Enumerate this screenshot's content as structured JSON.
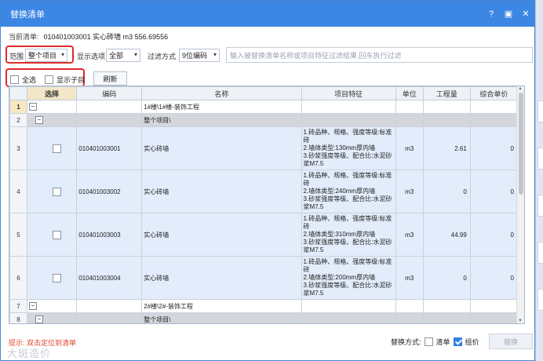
{
  "dialog": {
    "title": "替换清单",
    "buttons": {
      "help": "?",
      "restore": "▣",
      "close": "✕"
    }
  },
  "current": {
    "label": "当前清单:",
    "value": "010401003001 实心砖墙 m3 556.69556"
  },
  "filters": {
    "scope_label": "范围",
    "scope_value": "整个项目",
    "display_label": "显示选项",
    "display_value": "全部",
    "filter_label": "过滤方式",
    "filter_value": "9位编码",
    "search_placeholder": "输入被替换清单名称或项目特征过滤结果,回车执行过滤"
  },
  "options": {
    "select_all": "全选",
    "show_children": "显示子目",
    "refresh": "刷新"
  },
  "table": {
    "headers": [
      "",
      "选择",
      "编码",
      "名称",
      "项目特征",
      "单位",
      "工程量",
      "综合单价"
    ],
    "rows": [
      {
        "no": "1",
        "type": "unit",
        "name": "1#楼\\1#楼-装饰工程"
      },
      {
        "no": "2",
        "type": "grp",
        "name": "整个项目\\"
      },
      {
        "no": "3",
        "type": "item",
        "code": "010401003001",
        "name": "实心砖墙",
        "feature": "1.砖品种、规格、强度等级:标准砖\n2.墙体类型:130mm厚内墙\n3.砂浆强度等级、配合比:水泥砂浆M7.5",
        "unit": "m3",
        "qty": "2.61",
        "price": "0"
      },
      {
        "no": "4",
        "type": "item",
        "code": "010401003002",
        "name": "实心砖墙",
        "feature": "1.砖品种、规格、强度等级:标准砖\n2.墙体类型:240mm厚内墙\n3.砂浆强度等级、配合比:水泥砂浆M7.5",
        "unit": "m3",
        "qty": "0",
        "price": "0"
      },
      {
        "no": "5",
        "type": "item",
        "code": "010401003003",
        "name": "实心砖墙",
        "feature": "1.砖品种、规格、强度等级:标准砖\n2.墙体类型:310mm厚内墙\n3.砂浆强度等级、配合比:水泥砂浆M7.5",
        "unit": "m3",
        "qty": "44.99",
        "price": "0"
      },
      {
        "no": "6",
        "type": "item",
        "code": "010401003004",
        "name": "实心砖墙",
        "feature": "1.砖品种、规格、强度等级:标准砖\n2.墙体类型:200mm厚内墙\n3.砂浆强度等级、配合比:水泥砂浆M7.5",
        "unit": "m3",
        "qty": "0",
        "price": "0"
      },
      {
        "no": "7",
        "type": "unit",
        "name": "2#楼\\2#-装饰工程"
      },
      {
        "no": "8",
        "type": "grp",
        "name": "整个项目\\"
      }
    ]
  },
  "footer": {
    "hint": "提示: 双击定位到清单",
    "watermark": "大斑造价",
    "mode_label": "替换方式:",
    "mode_list": "清单",
    "mode_group": "组价",
    "replace": "替换"
  }
}
